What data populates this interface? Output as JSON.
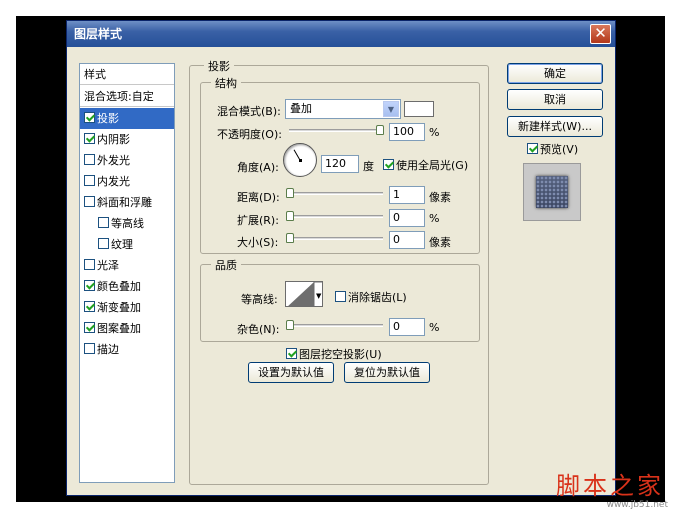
{
  "window": {
    "title": "图层样式",
    "close_glyph": "✕"
  },
  "styles_panel": {
    "header": "样式",
    "blend_options": "混合选项:自定",
    "items": [
      {
        "label": "投影",
        "checked": true,
        "selected": true,
        "indent": false
      },
      {
        "label": "内阴影",
        "checked": true,
        "selected": false,
        "indent": false
      },
      {
        "label": "外发光",
        "checked": false,
        "selected": false,
        "indent": false
      },
      {
        "label": "内发光",
        "checked": false,
        "selected": false,
        "indent": false
      },
      {
        "label": "斜面和浮雕",
        "checked": false,
        "selected": false,
        "indent": false
      },
      {
        "label": "等高线",
        "checked": false,
        "selected": false,
        "indent": true
      },
      {
        "label": "纹理",
        "checked": false,
        "selected": false,
        "indent": true
      },
      {
        "label": "光泽",
        "checked": false,
        "selected": false,
        "indent": false
      },
      {
        "label": "颜色叠加",
        "checked": true,
        "selected": false,
        "indent": false
      },
      {
        "label": "渐变叠加",
        "checked": true,
        "selected": false,
        "indent": false
      },
      {
        "label": "图案叠加",
        "checked": true,
        "selected": false,
        "indent": false
      },
      {
        "label": "描边",
        "checked": false,
        "selected": false,
        "indent": false
      }
    ]
  },
  "drop_shadow": {
    "section_title": "投影",
    "structure_title": "结构",
    "blend_mode_label": "混合模式(B):",
    "blend_mode_value": "叠加",
    "opacity_label": "不透明度(O):",
    "opacity_value": "100",
    "opacity_unit": "%",
    "opacity_level": 1.0,
    "angle_label": "角度(A):",
    "angle_value": "120",
    "angle_unit": "度",
    "global_light_label": "使用全局光(G)",
    "global_light_checked": true,
    "distance_label": "距离(D):",
    "distance_value": "1",
    "distance_unit": "像素",
    "spread_label": "扩展(R):",
    "spread_value": "0",
    "spread_unit": "%",
    "size_label": "大小(S):",
    "size_value": "0",
    "size_unit": "像素",
    "quality_title": "品质",
    "contour_label": "等高线:",
    "anti_alias_label": "消除锯齿(L)",
    "anti_alias_checked": false,
    "noise_label": "杂色(N):",
    "noise_value": "0",
    "noise_unit": "%",
    "knockout_label": "图层挖空投影(U)",
    "knockout_checked": true,
    "make_default_label": "设置为默认值",
    "reset_default_label": "复位为默认值"
  },
  "buttons": {
    "ok": "确定",
    "cancel": "取消",
    "new_style": "新建样式(W)...",
    "preview_label": "预览(V)",
    "preview_checked": true
  },
  "watermark": {
    "text": "脚本之家",
    "url": "www.jb51.net"
  }
}
